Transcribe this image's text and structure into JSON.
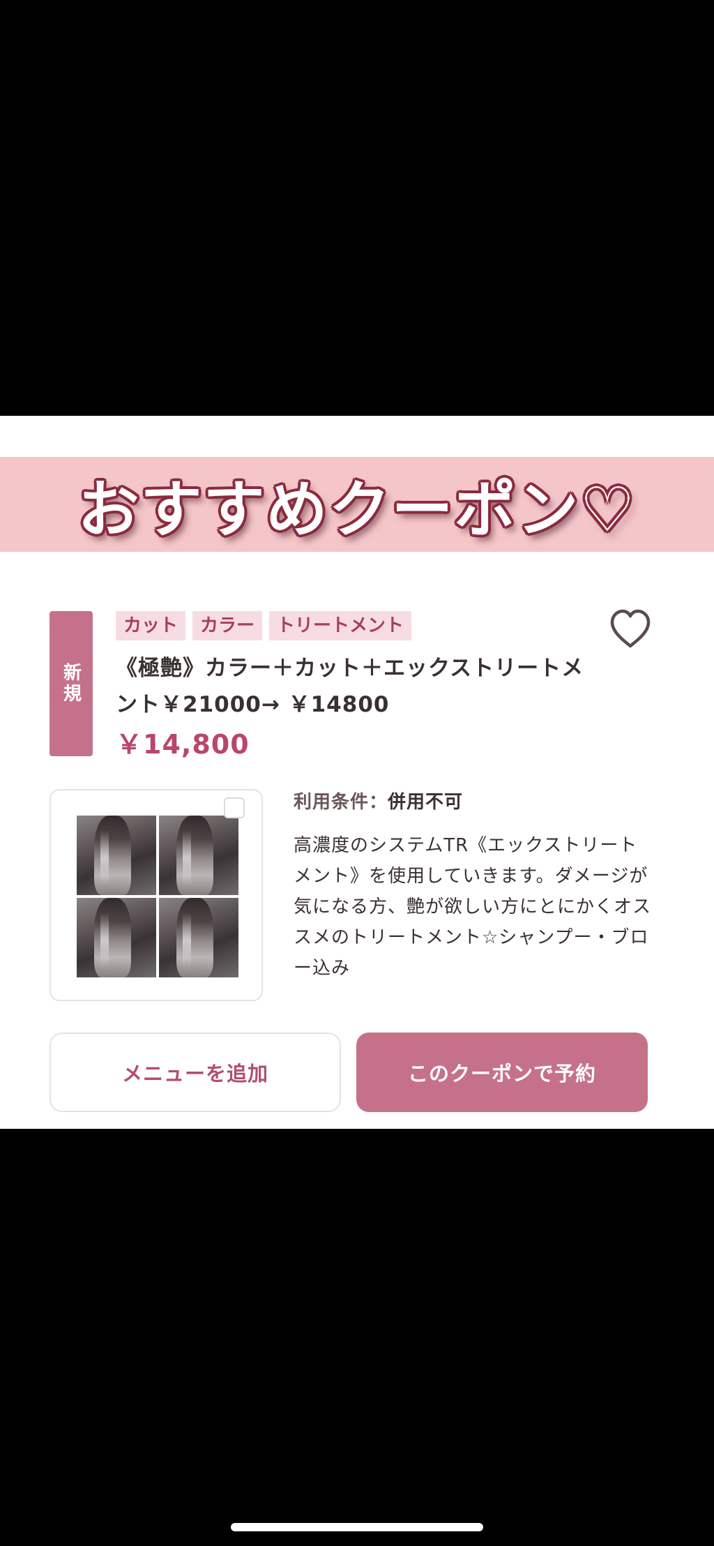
{
  "banner": {
    "text": "おすすめクーポン♡"
  },
  "coupon": {
    "new_badge": "新規",
    "tags": [
      "カット",
      "カラー",
      "トリートメント"
    ],
    "favorite_icon": "heart-outline-icon",
    "title": "《極艶》カラー＋カット＋エックストリートメント￥21000→ ￥14800",
    "price": "￥14,800",
    "conditions_label": "利用条件：",
    "conditions_value": "併用不可",
    "description": "高濃度のシステムTR《エックストリートメント》を使用していきます。ダメージが気になる方、艶が欲しい方にとにかくオススメのトリートメント☆シャンプー・ブロー込み"
  },
  "buttons": {
    "add_menu": "メニューを追加",
    "reserve": "このクーポンで予約"
  },
  "colors": {
    "accent": "#c6718a",
    "banner_bg": "#f4c6ca",
    "price": "#b8476a",
    "tag_bg": "#f7dde3"
  }
}
